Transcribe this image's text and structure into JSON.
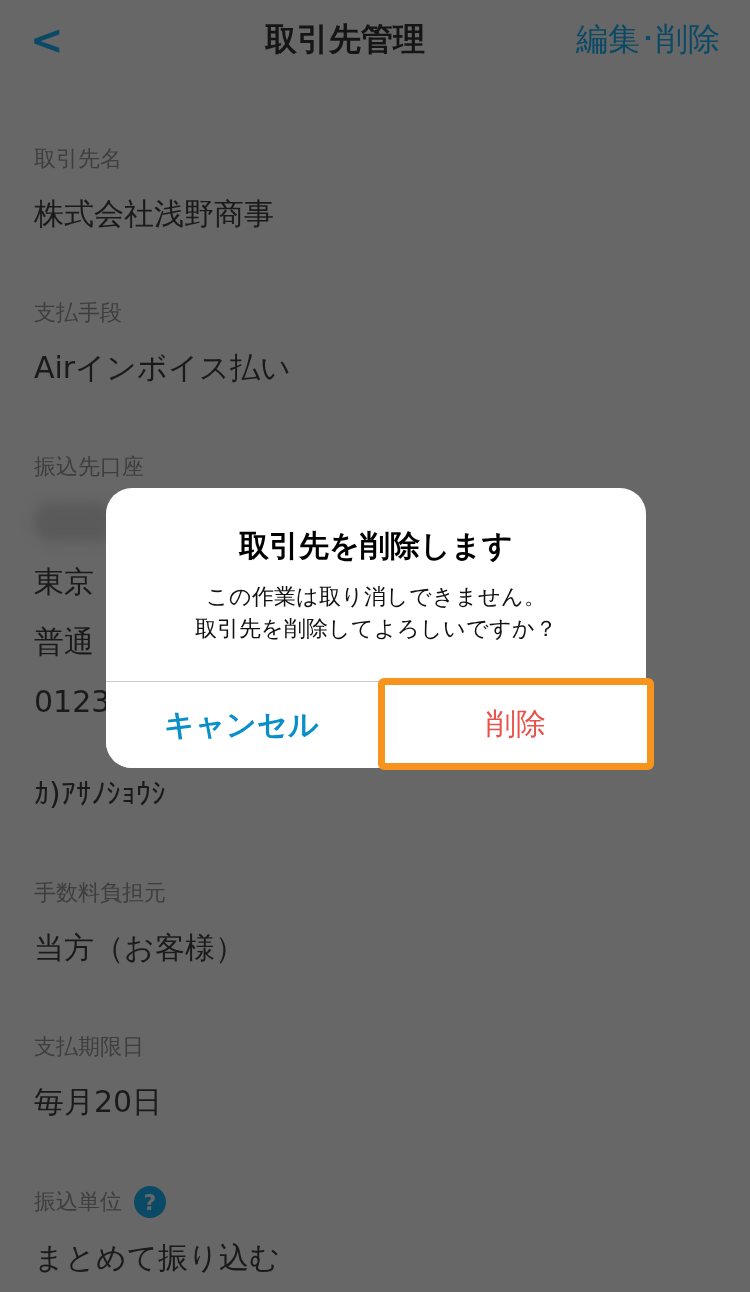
{
  "header": {
    "back": "<",
    "title": "取引先管理",
    "action": "編集･削除"
  },
  "fields": [
    {
      "kind": "text",
      "label": "取引先名",
      "lines": [
        "株式会社浅野商事"
      ]
    },
    {
      "kind": "text",
      "label": "支払手段",
      "lines": [
        "Airインボイス払い"
      ]
    },
    {
      "kind": "account",
      "label": "振込先口座",
      "lines": [
        "東京",
        "普通",
        "0123",
        "ｶ)ｱｻﾉｼｮｳｼ"
      ]
    },
    {
      "kind": "text",
      "label": "手数料負担元",
      "lines": [
        "当方（お客様）"
      ]
    },
    {
      "kind": "text",
      "label": "支払期限日",
      "lines": [
        "毎月20日"
      ]
    },
    {
      "kind": "help",
      "label": "振込単位",
      "help": "?",
      "lines": [
        "まとめて振り込む"
      ]
    }
  ],
  "dialog": {
    "title": "取引先を削除します",
    "message": [
      "この作業は取り消しできません。",
      "取引先を削除してよろしいですか？"
    ],
    "buttons": [
      {
        "label": "キャンセル",
        "kind": "cancel",
        "highlighted": false
      },
      {
        "label": "削除",
        "kind": "destructive",
        "highlighted": true
      }
    ]
  }
}
